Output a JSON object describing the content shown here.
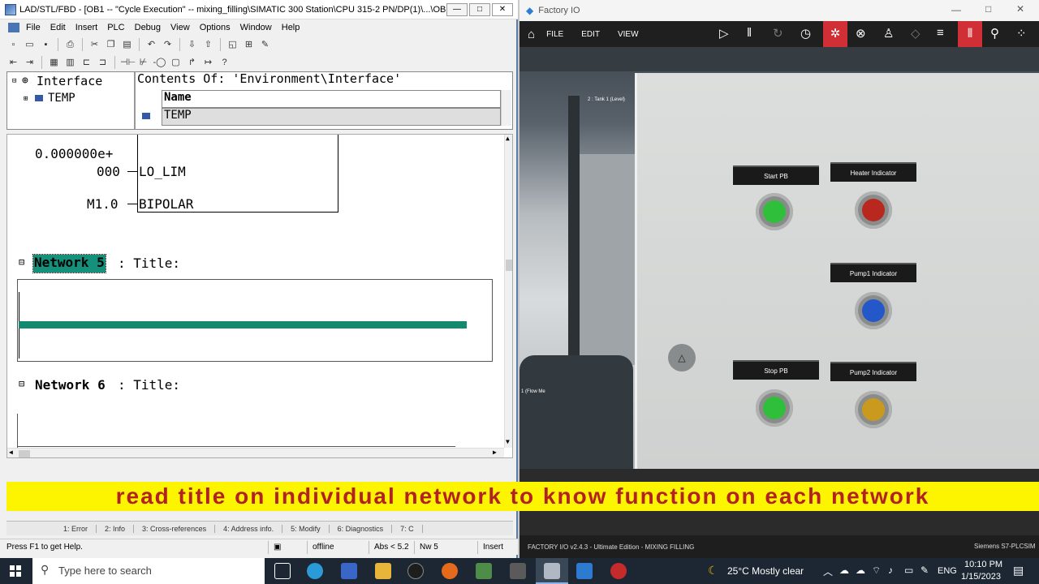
{
  "lad_window": {
    "title": "LAD/STL/FBD  - [OB1 -- \"Cycle Execution\" -- mixing_filling\\SIMATIC 300 Station\\CPU 315-2 PN/DP(1)\\...\\OB1]",
    "win_min": "—",
    "win_max": "□",
    "win_close": "✕",
    "menu": [
      "File",
      "Edit",
      "Insert",
      "PLC",
      "Debug",
      "View",
      "Options",
      "Window",
      "Help"
    ],
    "interface": {
      "contents_of": "Contents Of: 'Environment\\Interface'",
      "tree_root": "Interface",
      "tree_child": "TEMP",
      "col_header": "Name",
      "row_value": "TEMP"
    },
    "editor": {
      "block_const_line1": "0.000000e+",
      "block_const_line2": "000",
      "block_param1": "LO_LIM",
      "block_op2": "M1.0",
      "block_param2": "BIPOLAR",
      "network5_label": "Network 5",
      "network5_title": ": Title:",
      "network6_label": "Network 6",
      "network6_title": ": Title:"
    },
    "tabs": [
      "1: Error",
      "2: Info",
      "3: Cross-references",
      "4: Address info.",
      "5: Modify",
      "6: Diagnostics",
      "7: C"
    ],
    "status": {
      "help": "Press F1 to get Help.",
      "mode": "offline",
      "abs": "Abs < 5.2",
      "nw": "Nw 5",
      "ins": "Insert"
    }
  },
  "factory_io": {
    "title": "Factory IO",
    "menu": [
      "FILE",
      "EDIT",
      "VIEW"
    ],
    "labels": {
      "start_pb": "Start PB",
      "heater_indicator": "Heater Indicator",
      "pump1_indicator": "Pump1 Indicator",
      "stop_pb": "Stop PB",
      "pump2_indicator": "Pump2 Indicator",
      "tank_tag": "2 : Tank 1 (Level)",
      "flow_tag": "1 (Flow Me"
    },
    "lamp_colors": {
      "start": "#2fbf3a",
      "heater": "#b8281e",
      "pump1": "#2457c8",
      "stop": "#2fbf3a",
      "pump2": "#c99a1e"
    },
    "bottom_left": "FACTORY I/O v2.4.3 - Ultimate Edition - MIXING FILLING",
    "bottom_right": "Siemens S7-PLCSIM"
  },
  "caption": "read title on individual network to know function on each network",
  "taskbar": {
    "search_placeholder": "Type here to search",
    "weather": "25°C  Mostly clear",
    "lang": "ENG",
    "time": "10:10 PM",
    "date": "1/15/2023"
  }
}
